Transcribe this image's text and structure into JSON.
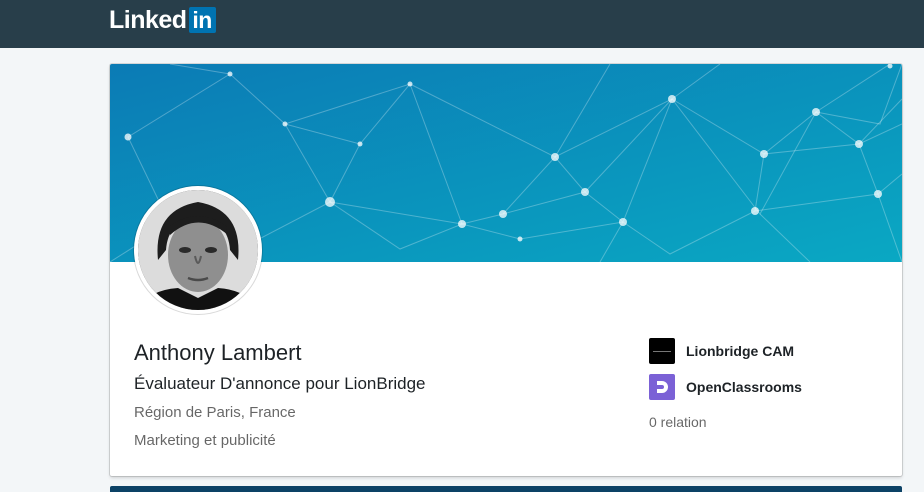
{
  "brand": {
    "logo_text": "Linked",
    "logo_badge": "in",
    "primary_color": "#0073b1",
    "header_color": "#283e4a"
  },
  "profile": {
    "name": "Anthony Lambert",
    "headline": "Évaluateur D'annonce pour LionBridge",
    "location": "Région de Paris, France",
    "industry": "Marketing et publicité",
    "avatar_icon": "profile-photo"
  },
  "organizations": [
    {
      "name": "Lionbridge CAM",
      "icon": "lionbridge-logo-icon",
      "color": "#000000"
    },
    {
      "name": "OpenClassrooms",
      "icon": "openclassrooms-logo-icon",
      "color": "#7b61d6"
    }
  ],
  "connections": "0 relation",
  "banner": {
    "gradient_start": "#0b7bb5",
    "gradient_end": "#0aa8c3"
  }
}
